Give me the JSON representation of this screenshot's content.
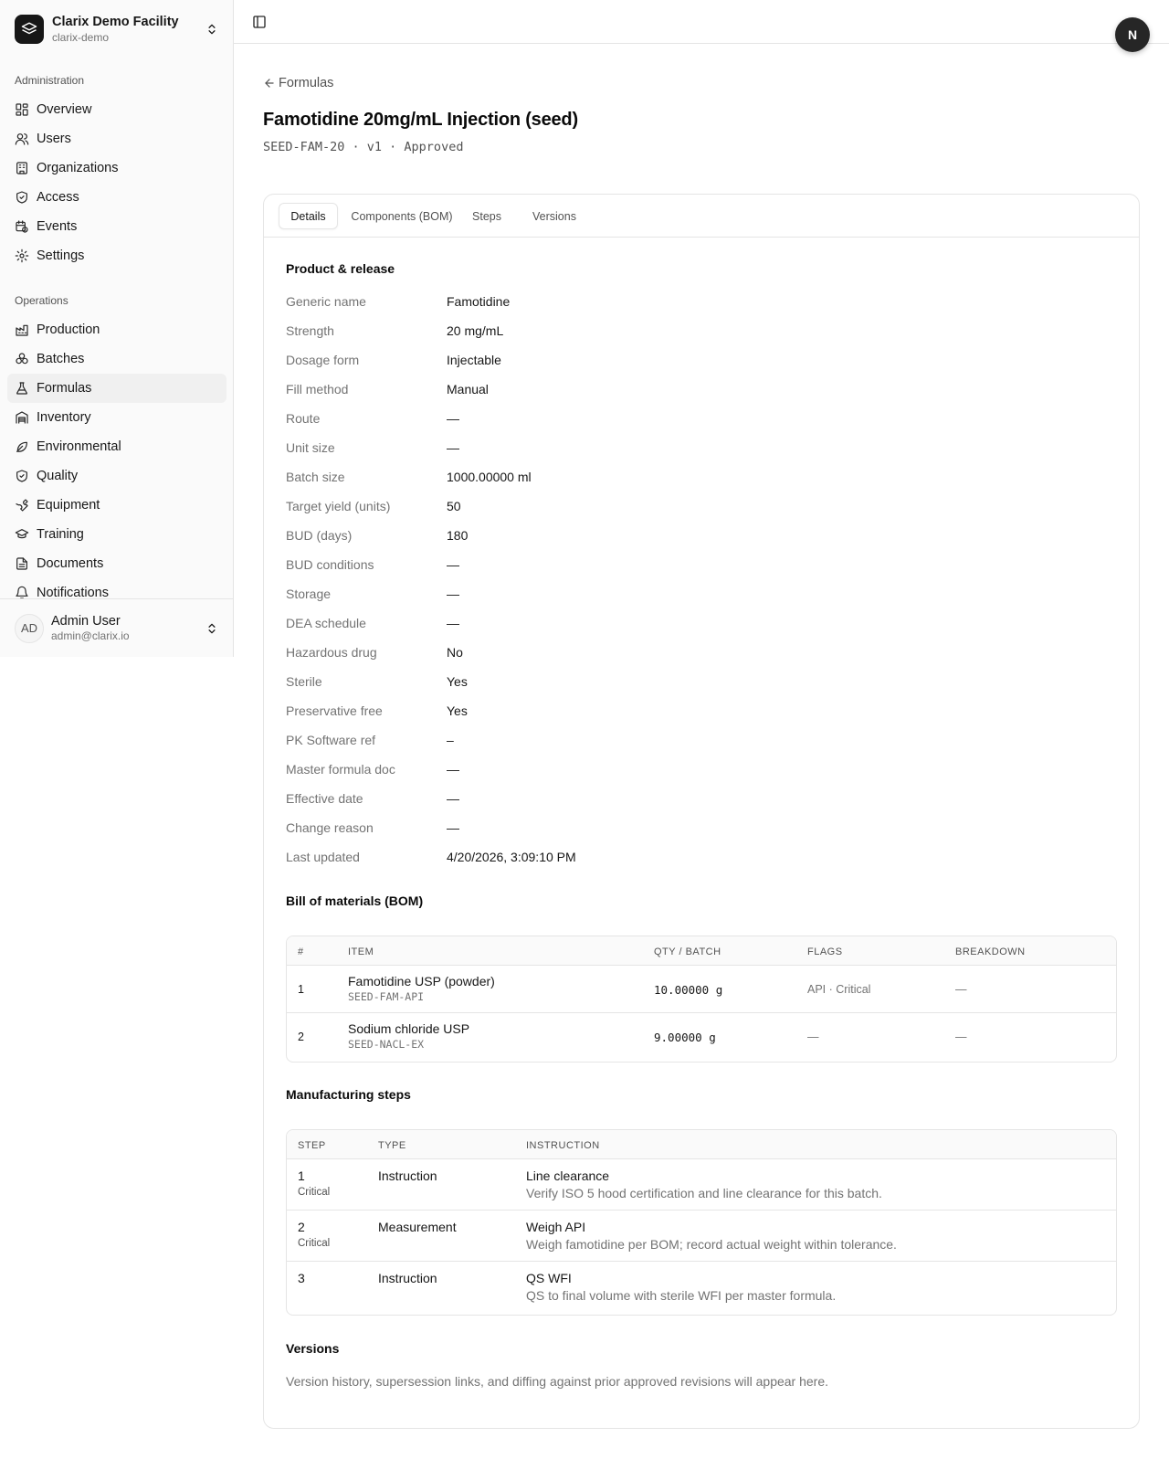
{
  "facility": {
    "name": "Clarix Demo Facility",
    "slug": "clarix-demo"
  },
  "nav": {
    "admin_label": "Administration",
    "admin_items": [
      {
        "label": "Overview",
        "icon": "grid-icon"
      },
      {
        "label": "Users",
        "icon": "users-icon"
      },
      {
        "label": "Organizations",
        "icon": "building-icon"
      },
      {
        "label": "Access",
        "icon": "shield-icon"
      },
      {
        "label": "Events",
        "icon": "calendar-clock-icon"
      },
      {
        "label": "Settings",
        "icon": "gear-icon"
      }
    ],
    "ops_label": "Operations",
    "ops_items": [
      {
        "label": "Production",
        "icon": "factory-icon"
      },
      {
        "label": "Batches",
        "icon": "boxes-icon"
      },
      {
        "label": "Formulas",
        "icon": "flask-icon",
        "active": true
      },
      {
        "label": "Inventory",
        "icon": "warehouse-icon"
      },
      {
        "label": "Environmental",
        "icon": "leaf-icon"
      },
      {
        "label": "Quality",
        "icon": "shield-check-icon"
      },
      {
        "label": "Equipment",
        "icon": "wrench-icon"
      },
      {
        "label": "Training",
        "icon": "graduation-cap-icon"
      },
      {
        "label": "Documents",
        "icon": "file-text-icon"
      },
      {
        "label": "Notifications",
        "icon": "bell-icon"
      }
    ]
  },
  "user": {
    "initials": "AD",
    "name": "Admin User",
    "email": "admin@clarix.io"
  },
  "topbar": {
    "badge": "N"
  },
  "page": {
    "back_label": "Formulas",
    "title": "Famotidine 20mg/mL Injection (seed)",
    "subtitle": "SEED-FAM-20 · v1 · Approved"
  },
  "tabs": [
    "Details",
    "Components (BOM)",
    "Steps",
    "Versions"
  ],
  "product": {
    "title": "Product & release",
    "rows": [
      {
        "label": "Generic name",
        "value": "Famotidine"
      },
      {
        "label": "Strength",
        "value": "20 mg/mL"
      },
      {
        "label": "Dosage form",
        "value": "Injectable"
      },
      {
        "label": "Fill method",
        "value": "Manual"
      },
      {
        "label": "Route",
        "value": "—"
      },
      {
        "label": "Unit size",
        "value": "—"
      },
      {
        "label": "Batch size",
        "value": "1000.00000 ml"
      },
      {
        "label": "Target yield (units)",
        "value": "50"
      },
      {
        "label": "BUD (days)",
        "value": "180"
      },
      {
        "label": "BUD conditions",
        "value": "—"
      },
      {
        "label": "Storage",
        "value": "—"
      },
      {
        "label": "DEA schedule",
        "value": "—"
      },
      {
        "label": "Hazardous drug",
        "value": "No"
      },
      {
        "label": "Sterile",
        "value": "Yes"
      },
      {
        "label": "Preservative free",
        "value": "Yes"
      },
      {
        "label": "PK Software ref",
        "value": "–"
      },
      {
        "label": "Master formula doc",
        "value": "—"
      },
      {
        "label": "Effective date",
        "value": "—"
      },
      {
        "label": "Change reason",
        "value": "—"
      },
      {
        "label": "Last updated",
        "value": "4/20/2026, 3:09:10 PM"
      }
    ]
  },
  "bom": {
    "title": "Bill of materials (BOM)",
    "headers": [
      "#",
      "ITEM",
      "QTY / BATCH",
      "FLAGS",
      "BREAKDOWN"
    ],
    "rows": [
      {
        "num": "1",
        "name": "Famotidine USP (powder)",
        "code": "SEED-FAM-API",
        "qty": "10.00000 g",
        "flags": "API · Critical",
        "breakdown": "—"
      },
      {
        "num": "2",
        "name": "Sodium chloride USP",
        "code": "SEED-NACL-EX",
        "qty": "9.00000 g",
        "flags": "—",
        "breakdown": "—"
      }
    ]
  },
  "steps": {
    "title": "Manufacturing steps",
    "headers": [
      "STEP",
      "TYPE",
      "INSTRUCTION"
    ],
    "rows": [
      {
        "num": "1",
        "flag": "Critical",
        "type": "Instruction",
        "title": "Line clearance",
        "desc": "Verify ISO 5 hood certification and line clearance for this batch."
      },
      {
        "num": "2",
        "flag": "Critical",
        "type": "Measurement",
        "title": "Weigh API",
        "desc": "Weigh famotidine per BOM; record actual weight within tolerance."
      },
      {
        "num": "3",
        "flag": "",
        "type": "Instruction",
        "title": "QS WFI",
        "desc": "QS to final volume with sterile WFI per master formula."
      }
    ]
  },
  "versions": {
    "title": "Versions",
    "note": "Version history, supersession links, and diffing against prior approved revisions will appear here."
  }
}
